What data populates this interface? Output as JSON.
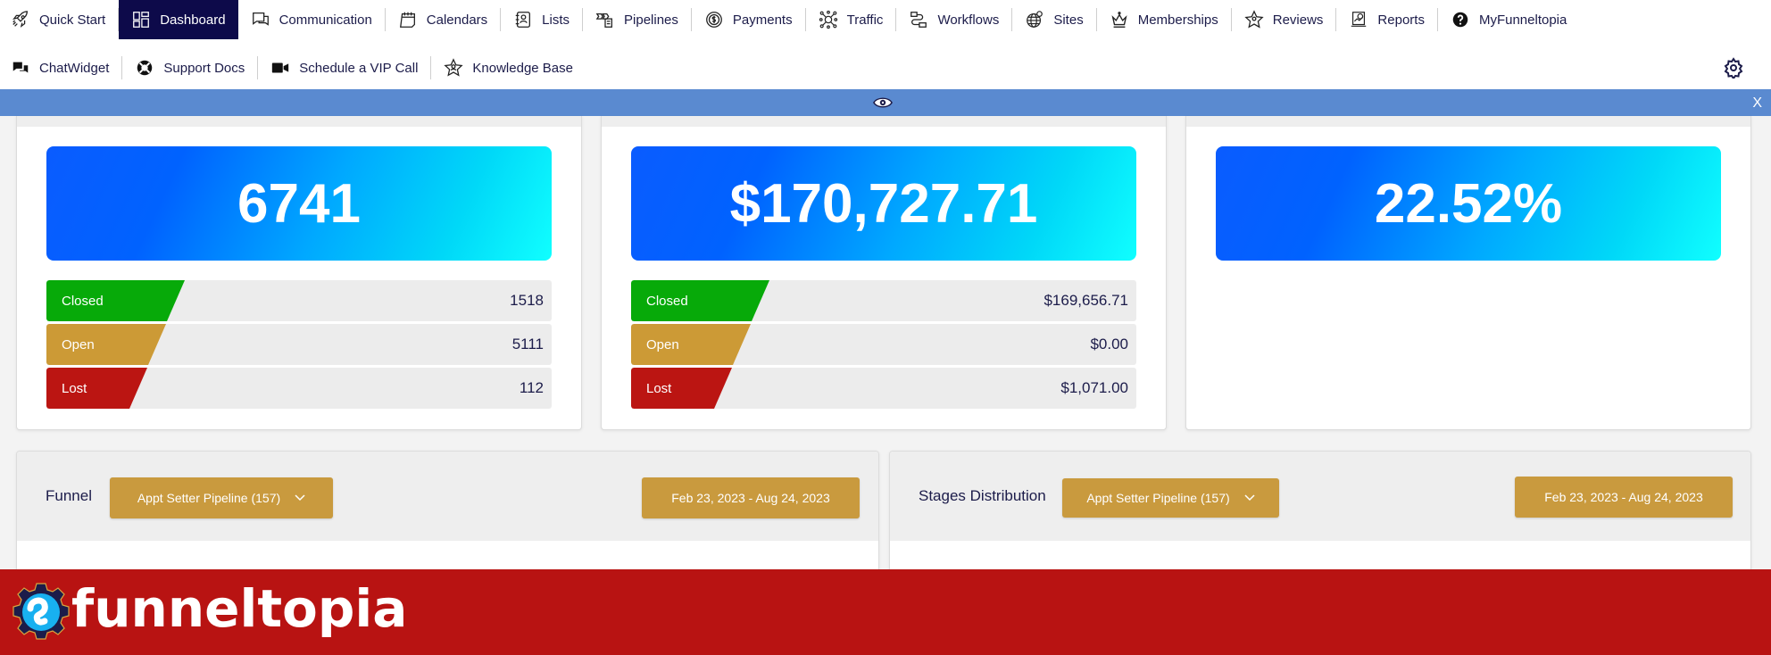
{
  "nav": {
    "row1": [
      {
        "label": "Quick Start",
        "icon": "rocket-icon",
        "active": false
      },
      {
        "label": "Dashboard",
        "icon": "dashboard-grid-icon",
        "active": true
      },
      {
        "label": "Communication",
        "icon": "chat-bubbles-icon",
        "active": false
      },
      {
        "label": "Calendars",
        "icon": "calendar-icon",
        "active": false
      },
      {
        "label": "Lists",
        "icon": "contact-book-icon",
        "active": false
      },
      {
        "label": "Pipelines",
        "icon": "pipeline-icon",
        "active": false
      },
      {
        "label": "Payments",
        "icon": "payments-icon",
        "active": false
      },
      {
        "label": "Traffic",
        "icon": "traffic-network-icon",
        "active": false
      },
      {
        "label": "Workflows",
        "icon": "workflow-icon",
        "active": false
      },
      {
        "label": "Sites",
        "icon": "globe-icon",
        "active": false
      },
      {
        "label": "Memberships",
        "icon": "crown-icon",
        "active": false
      },
      {
        "label": "Reviews",
        "icon": "star-icon",
        "active": false
      },
      {
        "label": "Reports",
        "icon": "reports-icon",
        "active": false
      },
      {
        "label": "MyFunneltopia",
        "icon": "question-circle-icon",
        "active": false
      }
    ],
    "row2": [
      {
        "label": "ChatWidget",
        "icon": "comments-icon"
      },
      {
        "label": "Support Docs",
        "icon": "life-ring-icon"
      },
      {
        "label": "Schedule a VIP Call",
        "icon": "video-camera-icon"
      },
      {
        "label": "Knowledge Base",
        "icon": "star-person-icon"
      }
    ],
    "settings_icon": "gear-icon"
  },
  "preview_bar": {
    "icon": "eye-icon",
    "close_label": "X",
    "color": "#5a8ad0"
  },
  "stats": [
    {
      "headline": "6741",
      "rows": [
        {
          "label": "Closed",
          "value": "1518"
        },
        {
          "label": "Open",
          "value": "5111"
        },
        {
          "label": "Lost",
          "value": "112"
        }
      ]
    },
    {
      "headline": "$170,727.71",
      "rows": [
        {
          "label": "Closed",
          "value": "$169,656.71"
        },
        {
          "label": "Open",
          "value": "$0.00"
        },
        {
          "label": "Lost",
          "value": "$1,071.00"
        }
      ]
    },
    {
      "headline": "22.52%",
      "rows": []
    }
  ],
  "status_colors": {
    "closed": "#07aa09",
    "open": "#cc9a36",
    "lost": "#bb1512"
  },
  "panels": [
    {
      "title": "Funnel",
      "pipeline_select": "Appt Setter Pipeline (157)",
      "date_range": "Feb 23, 2023 - Aug 24, 2023"
    },
    {
      "title": "Stages Distribution",
      "pipeline_select": "Appt Setter Pipeline (157)",
      "date_range": "Feb 23, 2023 - Aug 24, 2023"
    }
  ],
  "brand": {
    "name": "funneltopia",
    "bar_color": "#b81312",
    "accent_color": "#c99a3e"
  }
}
